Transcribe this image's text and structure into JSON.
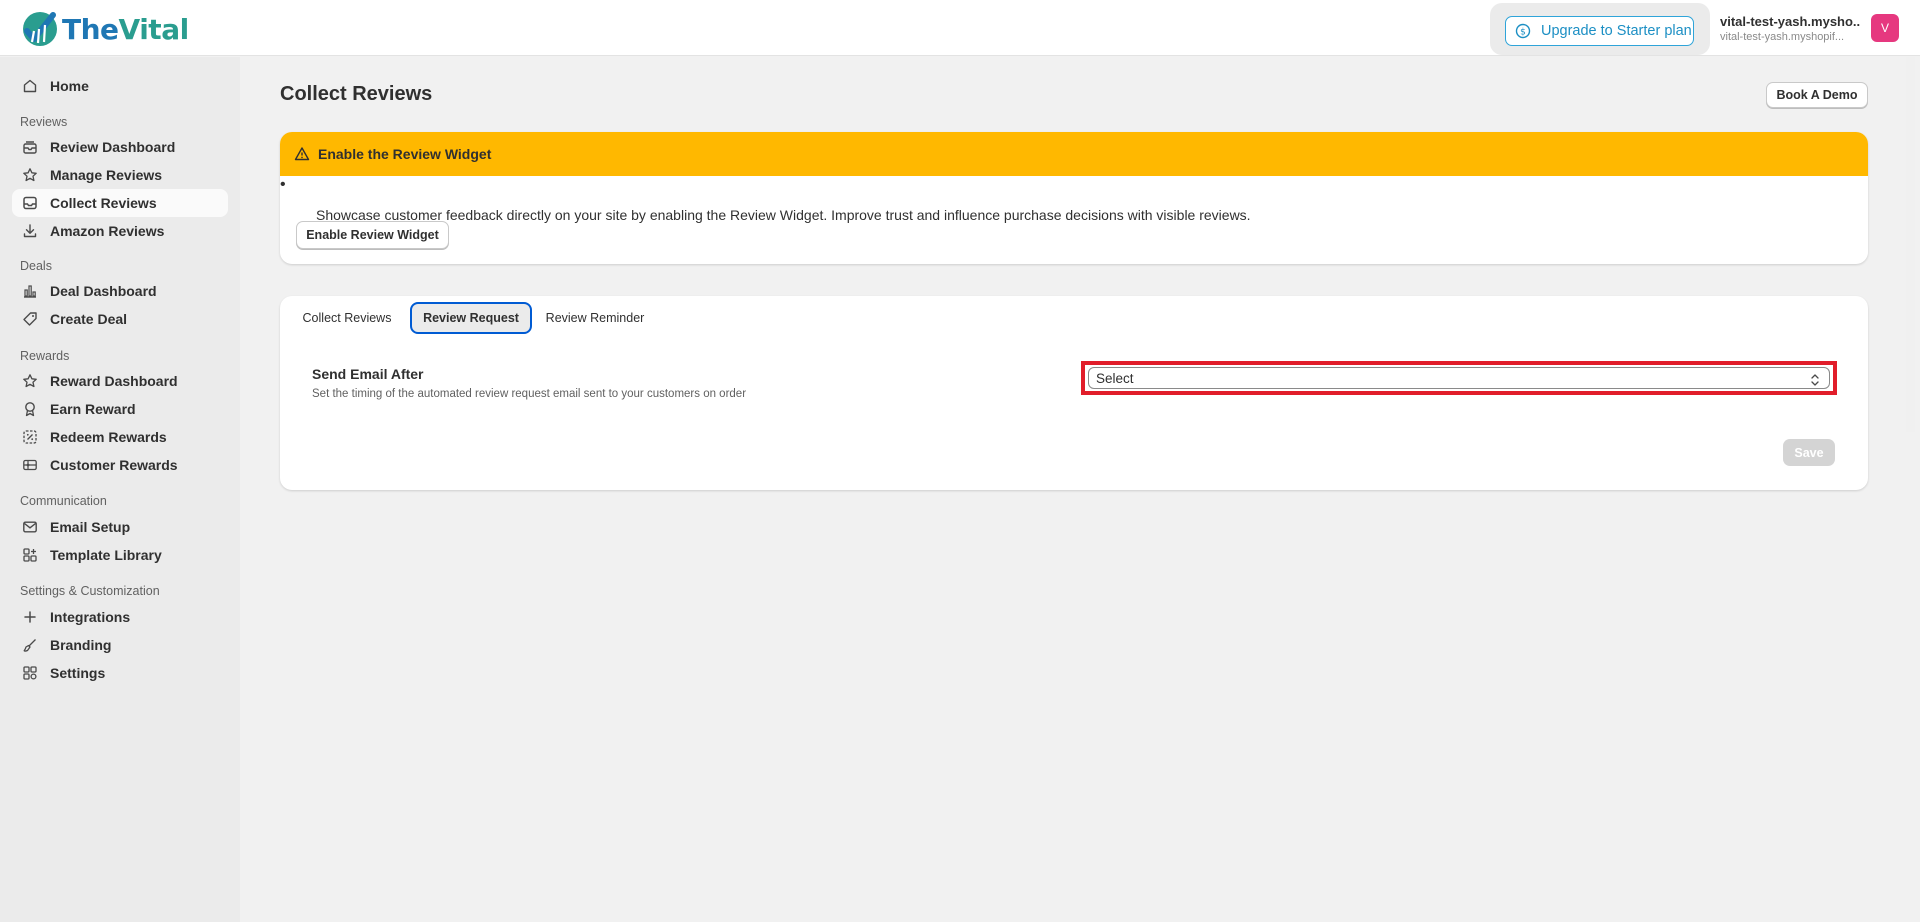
{
  "brand": {
    "name_part1": "The",
    "name_part2": "Vital"
  },
  "topbar": {
    "upgrade_label": "Upgrade to Starter plan",
    "upgrade_icon": "dollar-circle-icon",
    "account_name": "vital-test-yash.mysho...",
    "account_domain": "vital-test-yash.myshopif...",
    "avatar_initial": "V"
  },
  "sidebar": {
    "home": "Home",
    "sections": {
      "reviews": "Reviews",
      "deals": "Deals",
      "rewards": "Rewards",
      "communication": "Communication",
      "settings": "Settings & Customization"
    },
    "items": {
      "review_dashboard": "Review Dashboard",
      "manage_reviews": "Manage Reviews",
      "collect_reviews": "Collect Reviews",
      "amazon_reviews": "Amazon Reviews",
      "deal_dashboard": "Deal Dashboard",
      "create_deal": "Create Deal",
      "reward_dashboard": "Reward Dashboard",
      "earn_reward": "Earn Reward",
      "redeem_rewards": "Redeem Rewards",
      "customer_rewards": "Customer Rewards",
      "email_setup": "Email Setup",
      "template_library": "Template Library",
      "integrations": "Integrations",
      "branding": "Branding",
      "settings": "Settings"
    },
    "active_item": "Collect Reviews"
  },
  "main": {
    "title": "Collect Reviews",
    "book_demo_label": "Book A Demo",
    "banner": {
      "title": "Enable the Review Widget",
      "text": "Showcase customer feedback directly on your site by enabling the Review Widget. Improve trust and influence purchase decisions with visible reviews.",
      "button_label": "Enable Review Widget",
      "color": "#ffb800"
    },
    "tabs": [
      {
        "label": "Collect Reviews",
        "selected": false
      },
      {
        "label": "Review Request",
        "selected": true
      },
      {
        "label": "Review Reminder",
        "selected": false
      }
    ],
    "field": {
      "label": "Send Email After",
      "help": "Set the timing of the automated review request email sent to your customers on order",
      "select_value": "Select"
    },
    "save_label": "Save"
  }
}
